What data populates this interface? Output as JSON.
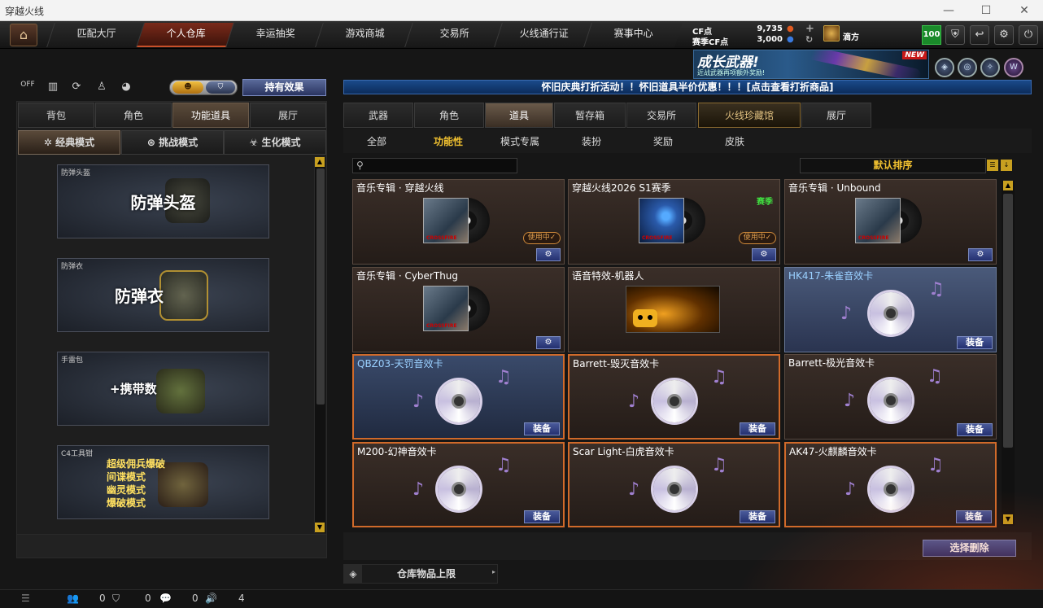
{
  "window": {
    "title": "穿越火线",
    "minimize": "—",
    "maximize": "☐",
    "close": "✕"
  },
  "nav": {
    "home_icon": "home-icon",
    "tabs": [
      "匹配大厅",
      "个人仓库",
      "幸运抽奖",
      "游戏商城",
      "交易所",
      "火线通行证",
      "赛事中心"
    ],
    "active_index": 1
  },
  "currency": {
    "cf_label": "CF点",
    "cf_value": "9,735",
    "season_label": "赛季CF点",
    "season_value": "3,000",
    "plus": "+",
    "refresh": "↻"
  },
  "user": {
    "name": "滴方",
    "level_badge": "100"
  },
  "top_icons": [
    "shield-icon",
    "return-icon",
    "gear-icon",
    "power-icon"
  ],
  "banner": {
    "title": "成长武器!",
    "subtitle": "近战武器再项额外奖励!",
    "badge": "NEW"
  },
  "left": {
    "off_label": "OFF",
    "effect_button": "持有效果",
    "tabs": [
      "背包",
      "角色",
      "功能道具",
      "展厅"
    ],
    "active_tab": 2,
    "modes": [
      "经典模式",
      "挑战模式",
      "生化模式"
    ],
    "active_mode": 0,
    "slots": [
      {
        "label": "防弹头盔",
        "title": "防弹头盔"
      },
      {
        "label": "防弹衣",
        "title": "防弹衣"
      },
      {
        "label": "手雷包",
        "title": "+携带数"
      },
      {
        "label": "C4工具钳",
        "lines": [
          "超级佣兵爆破",
          "间谍模式",
          "幽灵模式",
          "爆破模式"
        ]
      }
    ]
  },
  "notice": "怀旧庆典打折活动！！怀旧道具半价优惠！！！[点击查看打折商品]",
  "right": {
    "tabs": [
      "武器",
      "角色",
      "道具",
      "暂存箱",
      "交易所",
      "火线珍藏馆",
      "展厅"
    ],
    "active_tab": 2,
    "subtabs": [
      "全部",
      "功能性",
      "模式专属",
      "装扮",
      "奖励",
      "皮肤"
    ],
    "active_subtab": 1,
    "search_placeholder": "",
    "sort_label": "默认排序",
    "items": [
      {
        "name": "音乐专辑 · 穿越火线",
        "status": "使用中✓",
        "action": "⚙"
      },
      {
        "name": "穿越火线2026 S1赛季",
        "tag": "赛季",
        "status": "使用中✓",
        "action": "⚙"
      },
      {
        "name": "音乐专辑 · Unbound",
        "action": "⚙"
      },
      {
        "name": "音乐专辑 · CyberThug",
        "action": "⚙"
      },
      {
        "name": "语音特效-机器人"
      },
      {
        "name": "HK417-朱雀音效卡",
        "action": "装备"
      },
      {
        "name": "QBZ03-天罚音效卡",
        "action": "装备"
      },
      {
        "name": "Barrett-毁灭音效卡",
        "action": "装备"
      },
      {
        "name": "Barrett-极光音效卡",
        "action": "装备"
      },
      {
        "name": "M200-幻神音效卡",
        "action": "装备"
      },
      {
        "name": "Scar Light-白虎音效卡",
        "action": "装备"
      },
      {
        "name": "AK47-火麒麟音效卡",
        "action": "装备"
      }
    ],
    "delete_button": "选择删除",
    "capacity_label": "仓库物品上限"
  },
  "status": {
    "list_icon": "list-icon",
    "friends": "0",
    "clan": "0",
    "chat": "0",
    "volume": "4"
  }
}
